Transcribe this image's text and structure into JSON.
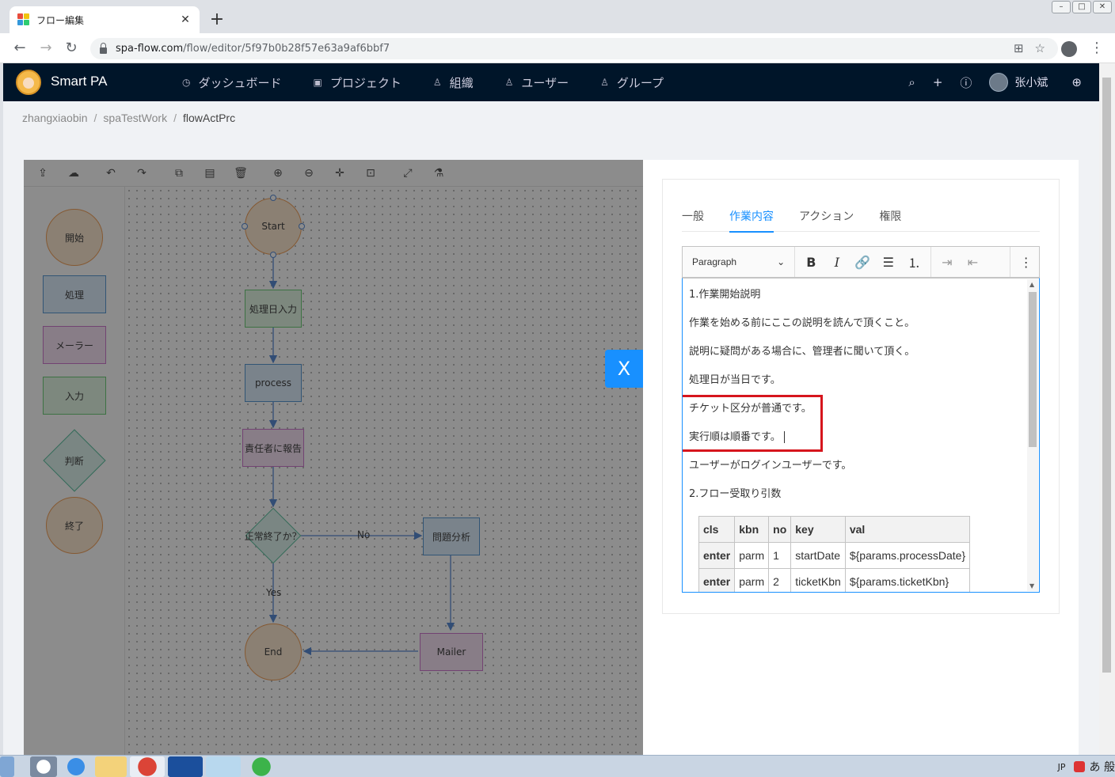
{
  "browser": {
    "tab_title": "フロー編集",
    "url_host": "spa-flow.com",
    "url_path": "/flow/editor/5f97b0b28f57e63a9af6bbf7"
  },
  "app": {
    "brand": "Smart PA",
    "nav": [
      {
        "label": "ダッシュボード"
      },
      {
        "label": "プロジェクト"
      },
      {
        "label": "組織"
      },
      {
        "label": "ユーザー"
      },
      {
        "label": "グループ"
      }
    ],
    "username": "张小斌"
  },
  "breadcrumb": [
    "zhangxiaobin",
    "spaTestWork",
    "flowActPrc"
  ],
  "stencil": {
    "start": "開始",
    "process": "処理",
    "mailer": "メーラー",
    "input": "入力",
    "decision": "判断",
    "end": "終了"
  },
  "flow": {
    "start": "Start",
    "input_node": "処理日入力",
    "process_node": "process",
    "report_node": "責任者に報告",
    "decision_node": "正常終了か？",
    "analysis_node": "問題分析",
    "end_node": "End",
    "mailer_node": "Mailer",
    "label_no": "No",
    "label_yes": "Yes"
  },
  "close_label": "X",
  "drawer": {
    "tabs": [
      {
        "label": "一般",
        "active": false
      },
      {
        "label": "作業内容",
        "active": true
      },
      {
        "label": "アクション",
        "active": false
      },
      {
        "label": "権限",
        "active": false
      }
    ],
    "paragraph_select": "Paragraph",
    "content": [
      "1.作業開始説明",
      "作業を始める前にここの説明を読んで頂くこと。",
      "説明に疑問がある場合に、管理者に聞いて頂く。",
      "処理日が当日です。",
      "チケット区分が普通です。",
      "実行順は順番です。",
      "ユーザーがログインユーザーです。",
      "2.フロー受取り引数"
    ],
    "table": {
      "headers": [
        "cls",
        "kbn",
        "no",
        "key",
        "val"
      ],
      "rows": [
        [
          "enter",
          "parm",
          "1",
          "startDate",
          "${params.processDate}"
        ],
        [
          "enter",
          "parm",
          "2",
          "ticketKbn",
          "${params.ticketKbn}"
        ]
      ]
    }
  },
  "taskbar": {
    "lang": "JP",
    "ime": "あ 般"
  },
  "colors": {
    "header_bg": "#001529",
    "accent": "#1890ff",
    "highlight": "#d6151d"
  }
}
